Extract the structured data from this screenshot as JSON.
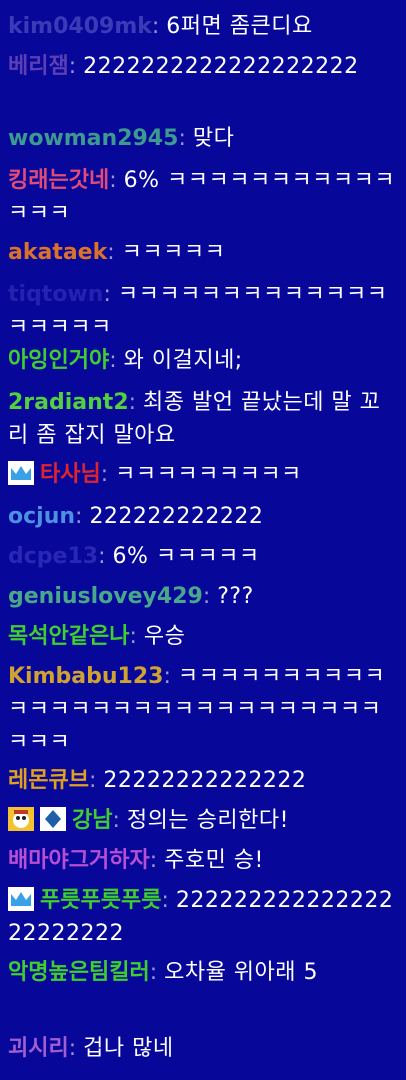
{
  "chat": {
    "messages": [
      {
        "user": "kim0409mk",
        "text": "6퍼면 좀큰디요",
        "color": "#3b3bb8"
      },
      {
        "user": "베리잼",
        "text": "2222222222222222222",
        "color": "#5c3fb5"
      },
      {
        "user": "wowman2945",
        "text": "맞다",
        "color": "#3c9a8e"
      },
      {
        "user": "킹래는갓네",
        "text": "6% ㅋㅋㅋㅋㅋㅋㅋㅋㅋㅋㅋㅋㅋㅋ",
        "color": "#e04b78"
      },
      {
        "user": "akataek",
        "text": "ㅋㅋㅋㅋㅋ",
        "color": "#d9722d"
      },
      {
        "user": "tiqtown",
        "text": "ㅋㅋㅋㅋㅋㅋㅋㅋㅋㅋㅋㅋㅋㅋㅋㅋㅋㅋ",
        "color": "#2323b0"
      },
      {
        "user": "아잉인거야",
        "text": "와 이걸지네;",
        "color": "#3fcf2e"
      },
      {
        "user": "2radiant2",
        "text": "최종 발언 끝났는데 말 꼬리 좀 잡지 말아요",
        "color": "#52d13f"
      },
      {
        "user": "타사님",
        "text": "ㅋㅋㅋㅋㅋㅋㅋㅋㅋ",
        "color": "#e0242e",
        "badge": "crown"
      },
      {
        "user": "ocjun",
        "text": "222222222222",
        "color": "#4d8fe0"
      },
      {
        "user": "dcpe13",
        "text": "6% ㅋㅋㅋㅋㅋ",
        "color": "#2828b5"
      },
      {
        "user": "geniuslovey429",
        "text": "???",
        "color": "#49a88a"
      },
      {
        "user": "목석안같은나",
        "text": "우승",
        "color": "#3fcf2e"
      },
      {
        "user": "Kimbabu123",
        "text": "ㅋㅋㅋㅋㅋㅋㅋㅋㅋㅋㅋㅋㅋㅋㅋㅋㅋㅋㅋㅋㅋㅋㅋㅋㅋㅋㅋㅋㅋㅋㅋ",
        "color": "#cfa231"
      },
      {
        "user": "레몬큐브",
        "text": "22222222222222",
        "color": "#e0a020"
      },
      {
        "user": "강남",
        "text": "정의는 승리한다!",
        "color": "#3fcf2e",
        "badge": "double"
      },
      {
        "user": "배마야그거하자",
        "text": "주호민 승!",
        "color": "#b74fd6"
      },
      {
        "user": "푸릇푸릇푸릇",
        "text": "22222222222222222222222",
        "color": "#3fcf2e",
        "badge": "crown"
      },
      {
        "user": "악명높은팀킬러",
        "text": "오차율 위아래 5",
        "color": "#3fcf2e"
      },
      {
        "user": "괴시리",
        "text": "겁나 많네",
        "color": "#a05fd0"
      }
    ],
    "separator": ": "
  }
}
